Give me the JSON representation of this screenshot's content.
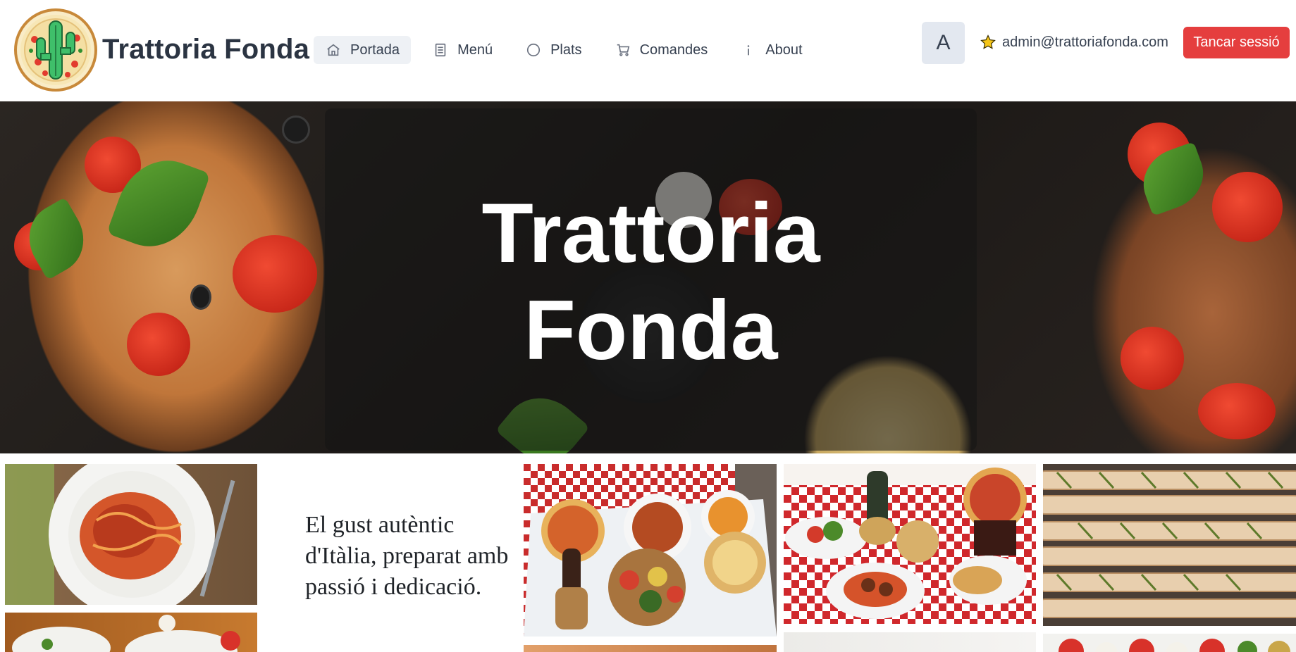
{
  "header": {
    "logo_icon": "cactus-pizza-logo",
    "brand": "Trattoria Fonda",
    "nav": [
      {
        "label": "Portada",
        "icon": "home-icon",
        "active": true
      },
      {
        "label": "Menú",
        "icon": "document-icon",
        "active": false
      },
      {
        "label": "Plats",
        "icon": "circle-icon",
        "active": false
      },
      {
        "label": "Comandes",
        "icon": "cart-icon",
        "active": false
      },
      {
        "label": "About",
        "icon": "info-icon",
        "active": false
      }
    ],
    "avatar_letter": "A",
    "user_email": "admin@trattoriafonda.com",
    "user_icon": "star-icon",
    "logout_label": "Tancar sessió"
  },
  "hero": {
    "title": "Trattoria\nFonda"
  },
  "gallery": {
    "tagline": "El gust autèntic d'Itàlia, preparat amb passió i dedicació.",
    "images": [
      "spaghetti-bolognese-photo",
      "italian-ingredients-photo",
      "italian-feast-table-photo",
      "checkered-tablecloth-dinner-photo",
      "breadsticks-photo",
      "marble-background-photo",
      "caprese-salad-photo",
      "pasta-dish-photo"
    ]
  },
  "colors": {
    "accent_red": "#e53e3e",
    "nav_active_bg": "#eef1f5",
    "avatar_bg": "#e3e8f0",
    "star": "#f5c518"
  }
}
